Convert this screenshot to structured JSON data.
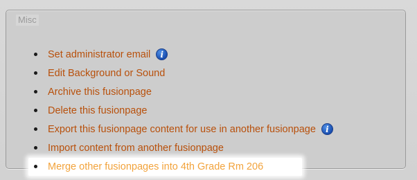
{
  "panel": {
    "legend": "Misc"
  },
  "menu": {
    "items": [
      {
        "label": "Set administrator email",
        "info": true
      },
      {
        "label": "Edit Background or Sound",
        "info": false
      },
      {
        "label": "Archive this fusionpage",
        "info": false
      },
      {
        "label": "Delete this fusionpage",
        "info": false
      },
      {
        "label": "Export this fusionpage content for use in another fusionpage",
        "info": true
      },
      {
        "label": "Import content from another fusionpage",
        "info": false
      },
      {
        "label": "Merge other fusionpages into 4th Grade Rm 206",
        "info": false,
        "highlighted": true
      }
    ]
  },
  "icons": {
    "info": "info-icon",
    "info_glyph": "i"
  },
  "colors": {
    "link": "#b8500b",
    "link_highlighted": "#f2a33c",
    "info_icon": "#1a4fb0",
    "panel_background": "#cdcdcd"
  }
}
